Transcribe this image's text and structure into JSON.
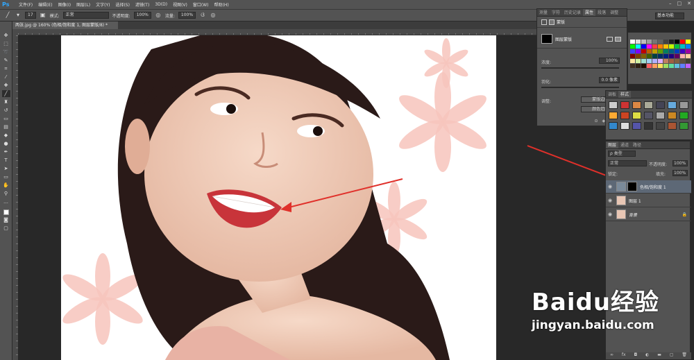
{
  "menubar": {
    "logo": "Ps",
    "items": [
      "文件(F)",
      "编辑(E)",
      "图像(I)",
      "图层(L)",
      "文字(Y)",
      "选择(S)",
      "滤镜(T)",
      "3D(D)",
      "视图(V)",
      "窗口(W)",
      "帮助(H)"
    ],
    "window_controls": [
      "–",
      "□",
      "✕"
    ]
  },
  "options": {
    "brush_size": "17",
    "mode_label": "模式:",
    "mode_value": "正常",
    "opacity_label": "不透明度:",
    "opacity_value": "100%",
    "flow_label": "流量:",
    "flow_value": "100%",
    "workspace": "基本功能"
  },
  "document": {
    "tab_title": "两张.jpg @ 160% (色相/饱和度 1, 图层蒙版/8) *"
  },
  "properties_panel": {
    "tabs": [
      "测量",
      "字符",
      "历史记录",
      "属性",
      "段落",
      "调整"
    ],
    "active_tab": "属性",
    "header": "蒙版",
    "mask_title": "图层蒙版",
    "density_label": "浓度:",
    "density_value": "100%",
    "feather_label": "羽化:",
    "feather_value": "0.0 像素",
    "adjust_label": "调整:",
    "btn_mask_edge": "蒙版边缘...",
    "btn_color_range": "颜色范围..."
  },
  "swatches": {
    "colors": [
      "#ffffff",
      "#e0e0e0",
      "#bdbdbd",
      "#9e9e9e",
      "#757575",
      "#616161",
      "#424242",
      "#212121",
      "#000000",
      "#ff0000",
      "#ffff00",
      "#00ff00",
      "#00ffff",
      "#0000ff",
      "#ff00ff",
      "#ff4040",
      "#ff8000",
      "#ffc000",
      "#c0ff00",
      "#00c040",
      "#00c0c0",
      "#0080ff",
      "#4040ff",
      "#8000ff",
      "#c00000",
      "#c06000",
      "#c0a000",
      "#60a000",
      "#008060",
      "#006080",
      "#0040c0",
      "#4000c0",
      "#a000a0",
      "#800000",
      "#804000",
      "#806000",
      "#406000",
      "#004040",
      "#003060",
      "#002080",
      "#200080",
      "#600060",
      "#ffb0b0",
      "#ffd0a0",
      "#ffe8a0",
      "#d0f0a0",
      "#a0e0d0",
      "#a0d0f0",
      "#b0b0ff",
      "#e0b0ff",
      "#c08060",
      "#a06040",
      "#806040",
      "#605040",
      "#404030",
      "#403020",
      "#302010",
      "#201000",
      "#ff6060",
      "#ffa060",
      "#ffe060",
      "#a0e060",
      "#60e0a0",
      "#60c0e0",
      "#6080ff",
      "#c060ff"
    ]
  },
  "styles_panel": {
    "tabs": [
      "调板",
      "样式"
    ],
    "active_tab": "样式"
  },
  "layers_panel": {
    "tabs": [
      "图层",
      "通道",
      "路径"
    ],
    "filter_label": "ρ 类型",
    "blend_mode": "正常",
    "opacity_label": "不透明度:",
    "opacity_value": "100%",
    "lock_label": "锁定:",
    "fill_label": "填充:",
    "fill_value": "100%",
    "layers": [
      {
        "name": "色相/饱和度 1",
        "selected": true
      },
      {
        "name": "图层 1",
        "selected": false
      },
      {
        "name": "背景",
        "selected": false
      }
    ]
  },
  "watermark": {
    "brand": "Baidu经验",
    "url": "jingyan.baidu.com"
  },
  "colors": {
    "ui_bg": "#535353",
    "canvas_bg": "#282828",
    "arrow": "#e0302a",
    "selection": "#5d6876"
  }
}
